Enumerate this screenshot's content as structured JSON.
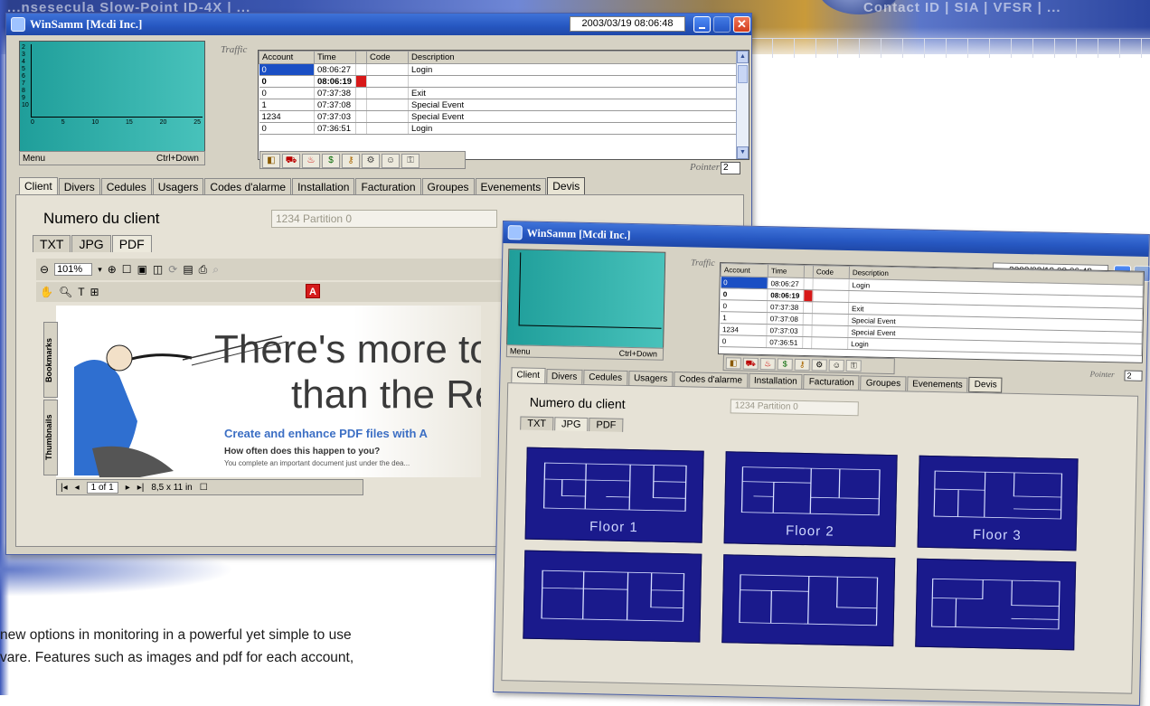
{
  "banner": {
    "left_text": "...nsesecula Slow-Point ID-4X | ...",
    "right_text": "Contact ID | SIA | VFSR | ..."
  },
  "window1": {
    "title": "WinSamm [Mcdi Inc.]",
    "datetime": "2003/03/19  08:06:48",
    "close_glyph": "✕",
    "traffic_label": "Traffic",
    "menu_label": "Menu",
    "menu_shortcut": "Ctrl+Down",
    "y_labels": [
      "2",
      "3",
      "4",
      "5",
      "6",
      "7",
      "8",
      "9",
      "10"
    ],
    "x_labels": [
      "0",
      "5",
      "10",
      "15",
      "20",
      "25"
    ],
    "pointer_label": "Pointer",
    "pointer_value": "2",
    "grid": {
      "headers": [
        "Account",
        "Time",
        "Code",
        "Description"
      ],
      "rows": [
        {
          "account": "0",
          "time": "08:06:27",
          "code": "",
          "description": "Login"
        },
        {
          "account": "0",
          "time": "08:06:19",
          "code": "",
          "description": ""
        },
        {
          "account": "0",
          "time": "07:37:38",
          "code": "",
          "description": "Exit"
        },
        {
          "account": "1",
          "time": "07:37:08",
          "code": "",
          "description": "Special Event"
        },
        {
          "account": "1234",
          "time": "07:37:03",
          "code": "",
          "description": "Special Event"
        },
        {
          "account": "0",
          "time": "07:36:51",
          "code": "",
          "description": "Login"
        }
      ]
    },
    "tabs": [
      "Client",
      "Divers",
      "Cedules",
      "Usagers",
      "Codes d'alarme",
      "Installation",
      "Facturation",
      "Groupes",
      "Evenements",
      "Devis"
    ],
    "client_number_label": "Numero du client",
    "client_number_value": "1234 Partition 0",
    "subtabs": [
      "TXT",
      "JPG",
      "PDF"
    ],
    "pdf": {
      "zoom": "101%",
      "headline1": "There's more to",
      "headline2": "than the Re",
      "subhead": "Create and enhance PDF files with A",
      "body1": "How often does this happen to you?",
      "body2": "You complete an important document just under the dea...",
      "sidetab_bookmarks": "Bookmarks",
      "sidetab_thumbnails": "Thumbnails",
      "page": "1 of 1",
      "page_size": "8,5 x 11 in"
    }
  },
  "window2": {
    "title": "WinSamm [Mcdi Inc.]",
    "datetime": "2003/03/19  08:06:48",
    "traffic_label": "Traffic",
    "menu_label": "Menu",
    "menu_shortcut": "Ctrl+Down",
    "pointer_label": "Pointer",
    "pointer_value": "2",
    "tabs": [
      "Client",
      "Divers",
      "Cedules",
      "Usagers",
      "Codes d'alarme",
      "Installation",
      "Facturation",
      "Groupes",
      "Evenements",
      "Devis"
    ],
    "client_number_label": "Numero du client",
    "client_number_value": "1234 Partition 0",
    "subtabs": [
      "TXT",
      "JPG",
      "PDF"
    ],
    "floors": [
      "Floor 1",
      "Floor 2",
      "Floor 3",
      "",
      "",
      ""
    ]
  },
  "blurb": {
    "line1": "new options in monitoring in a powerful yet simple to use",
    "line2": "vare. Features such as images and pdf for each account,"
  },
  "colors": {
    "titlebar": "#2758c2",
    "window_bg": "#d6d2c4",
    "traffic_teal": "#3bb3ad",
    "floor_blue": "#1a1a8c",
    "selected_row": "#1a4fc4"
  }
}
